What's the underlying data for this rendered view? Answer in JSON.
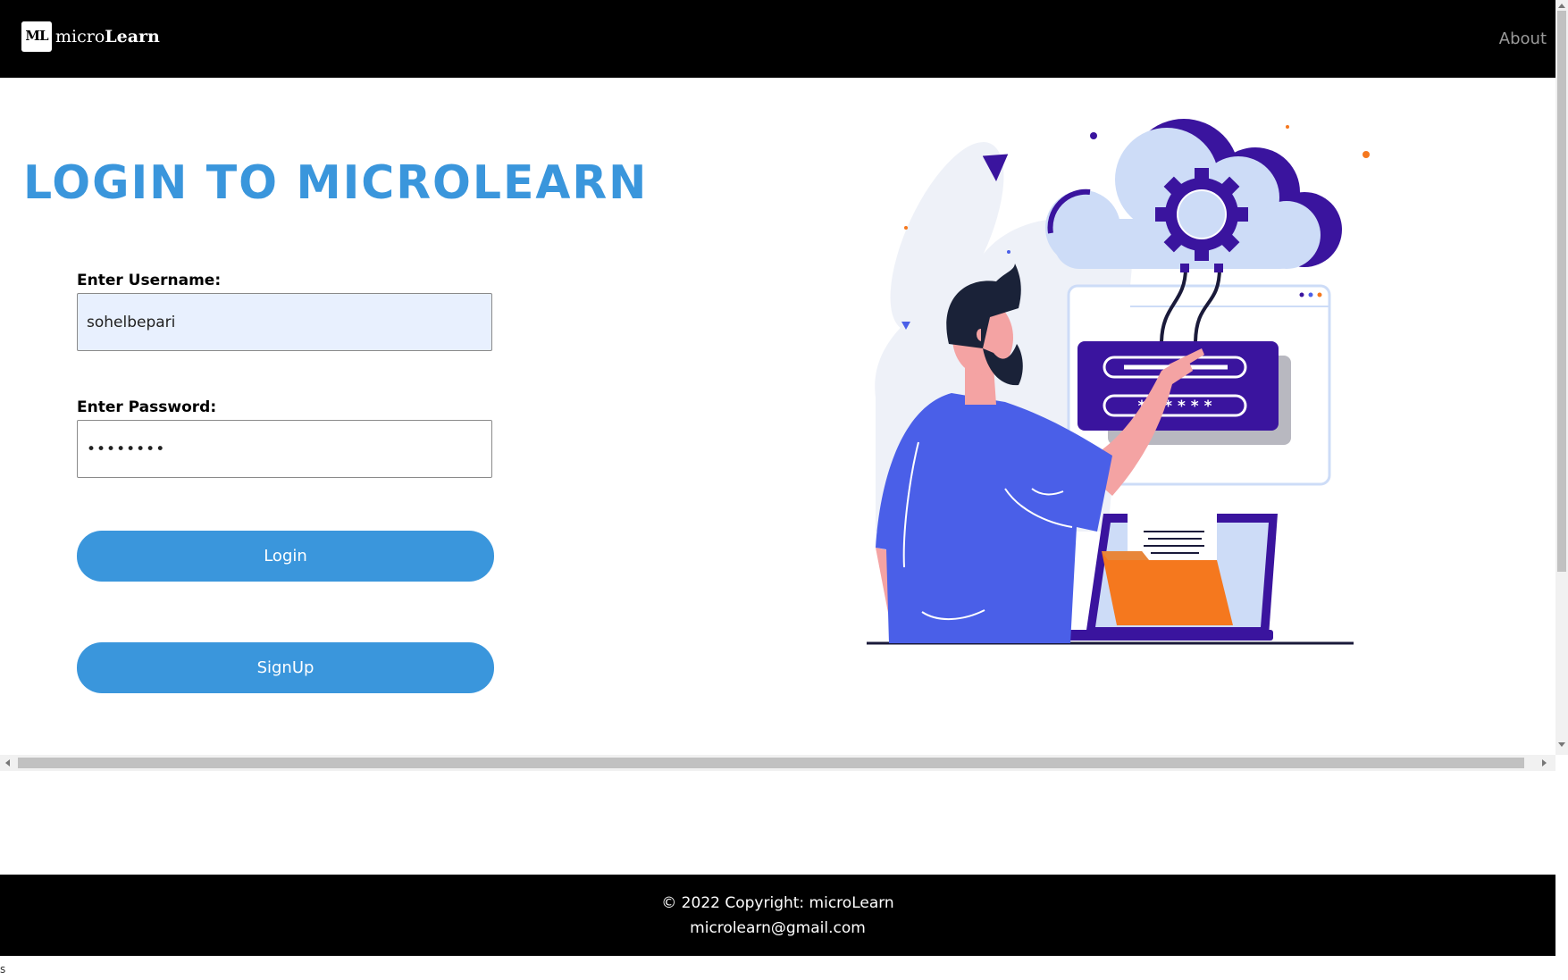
{
  "navbar": {
    "logo_text": "ML",
    "brand_prefix": "micro",
    "brand_suffix": "Learn",
    "about_link": "About"
  },
  "main": {
    "title": "LOGIN TO MICROLEARN",
    "username_label": "Enter Username:",
    "username_value": "sohelbepari",
    "password_label": "Enter Password:",
    "password_value": "••••••••",
    "login_button": "Login",
    "signup_button": "SignUp"
  },
  "illustration": {
    "username_mask": "",
    "password_mask": "* * * * * *"
  },
  "footer": {
    "copyright": "© 2022 Copyright: microLearn",
    "email": "microlearn@gmail.com"
  },
  "stray_text": "s",
  "colors": {
    "accent": "#3a96dc",
    "navbar_bg": "#000000",
    "autofill_bg": "#e8f0fe",
    "illustration_purple": "#3a149e",
    "illustration_blue": "#4a5fe8",
    "illustration_orange": "#f5781e"
  }
}
